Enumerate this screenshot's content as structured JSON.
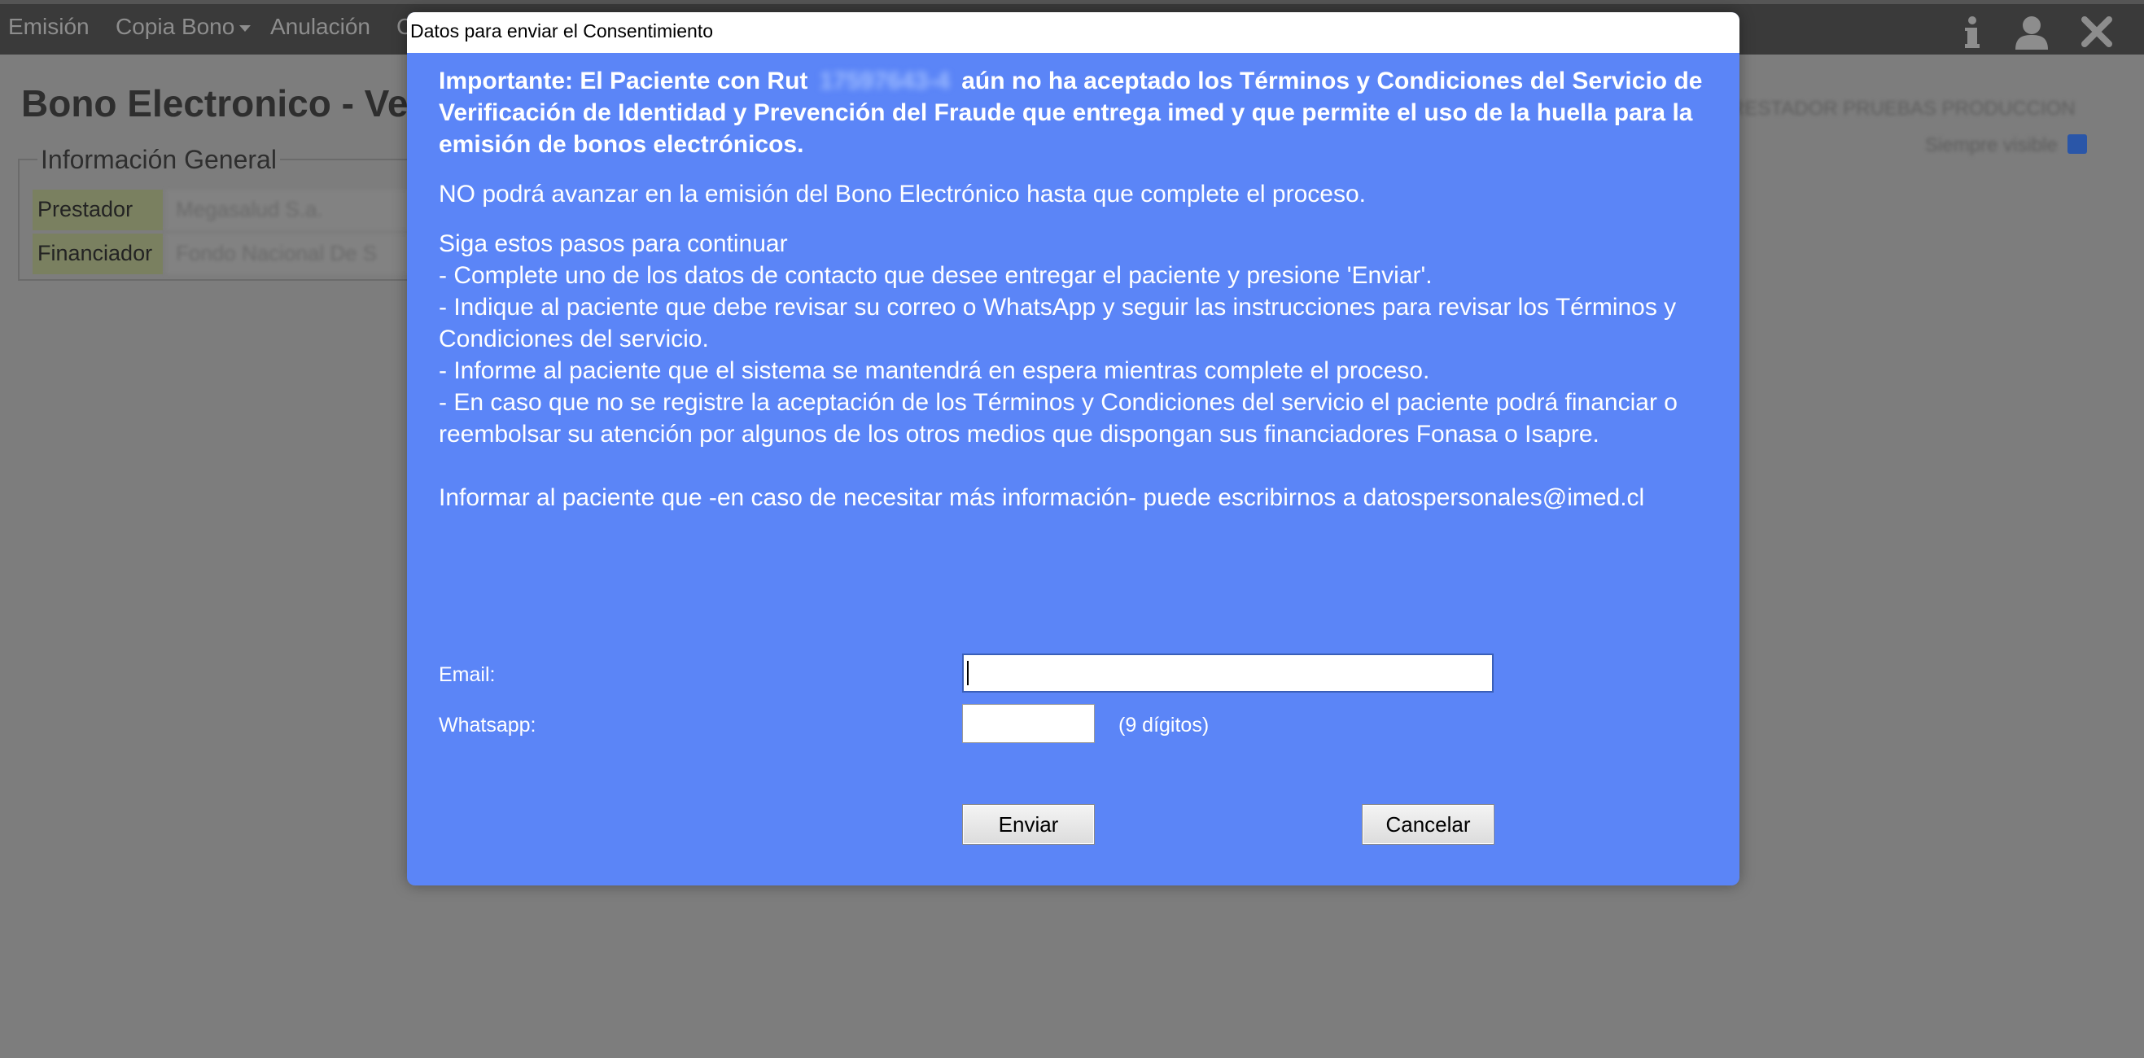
{
  "topbar": {
    "menu": [
      {
        "label": "Emisión",
        "has_dropdown": false
      },
      {
        "label": "Copia Bono",
        "has_dropdown": true
      },
      {
        "label": "Anulación",
        "has_dropdown": false
      },
      {
        "label": "C",
        "has_dropdown": false
      }
    ],
    "icons": [
      "info-icon",
      "user-icon",
      "close-icon"
    ]
  },
  "background": {
    "page_title": "Bono Electronico - Ver",
    "section_title": "Información General",
    "rows": [
      {
        "label": "Prestador",
        "value": "Megasalud S.a."
      },
      {
        "label": "Financiador",
        "value": "Fondo Nacional De S"
      }
    ],
    "right_text": "PRESTADOR PRUEBAS PRODUCCION",
    "right_text2": "Siempre visible"
  },
  "dialog": {
    "title": "Datos para enviar el Consentimiento",
    "important_prefix": "Importante: El Paciente con Rut",
    "rut": "17597643-4",
    "important_suffix": "aún no ha aceptado los Términos y Condiciones del Servicio de Verificación de Identidad y Prevención del Fraude que entrega imed y que permite el uso de la huella para la emisión de bonos electrónicos.",
    "warning": "NO podrá avanzar en la emisión del Bono Electrónico hasta que complete el proceso.",
    "steps_intro": "Siga estos pasos para continuar",
    "steps": [
      "- Complete uno de los datos de contacto que desee entregar el paciente y presione 'Enviar'.",
      "- Indique al paciente que debe revisar su correo o WhatsApp y seguir las instrucciones para revisar los Términos y Condiciones del servicio.",
      "- Informe al paciente que el sistema se mantendrá en espera mientras complete el proceso.",
      "- En caso que no se registre la aceptación de los Términos y Condiciones del servicio el paciente podrá financiar o reembolsar su atención por algunos de los otros medios que dispongan sus financiadores Fonasa o Isapre."
    ],
    "contact_info": "Informar al paciente que -en caso de necesitar más información- puede escribirnos a datospersonales@imed.cl",
    "form": {
      "email_label": "Email:",
      "email_value": "",
      "whatsapp_label": "Whatsapp:",
      "whatsapp_value": "",
      "whatsapp_hint": "(9 dígitos)"
    },
    "buttons": {
      "send": "Enviar",
      "cancel": "Cancelar"
    }
  },
  "colors": {
    "dialog_bg": "#5b85f7",
    "overlay_bg": "#7d7d7d",
    "topbar_bg": "#3a3a3a"
  }
}
